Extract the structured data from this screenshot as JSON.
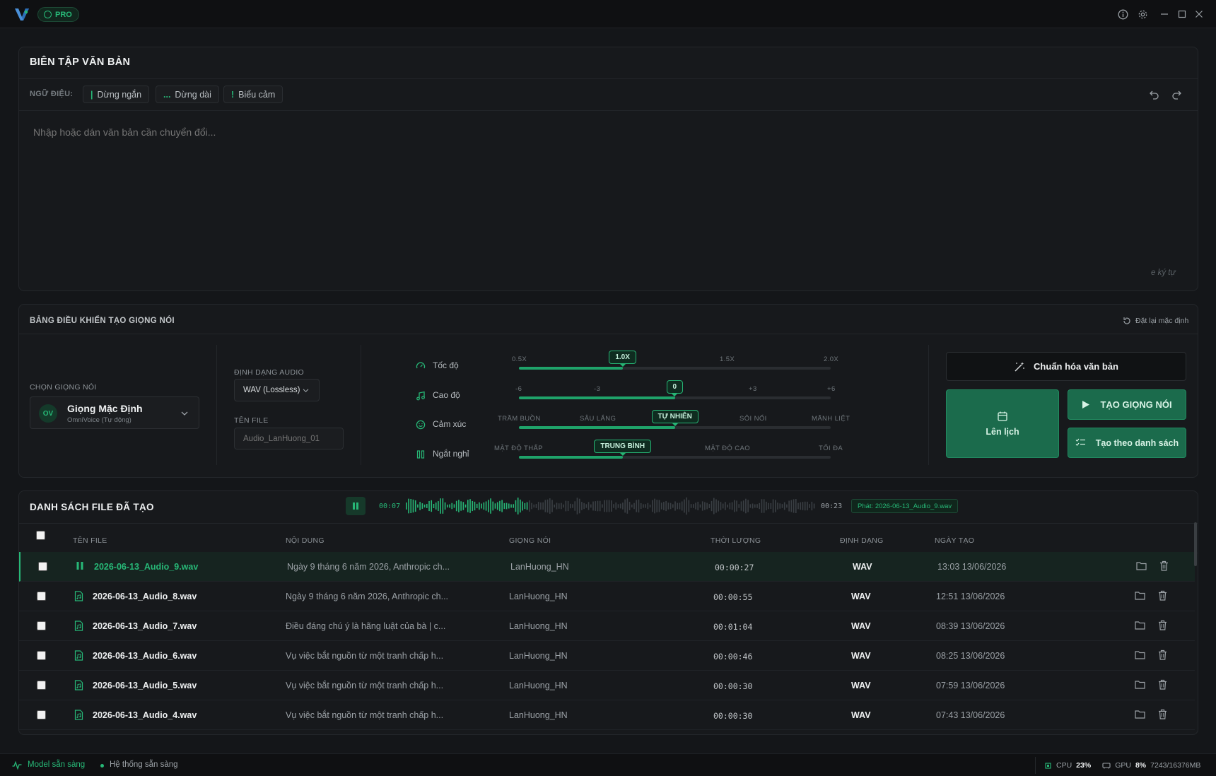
{
  "app": {
    "badge": "PRO"
  },
  "editor": {
    "title": "BIÊN TẬP VĂN BẢN",
    "prosody_label": "NGỮ ĐIỆU:",
    "chips": [
      "Dừng ngắn",
      "Dừng dài",
      "Biểu cảm"
    ],
    "placeholder": "Nhập hoặc dán văn bản cần chuyển đổi...",
    "char_count": "e ký tự"
  },
  "control": {
    "title": "BẢNG ĐIỀU KHIỂN TẠO GIỌNG NÓI",
    "reset": "Đặt lại mặc định",
    "voice_label": "CHỌN GIỌNG NÓI",
    "voice_avatar": "OV",
    "voice_name": "Giọng Mặc Định",
    "voice_sub": "OmniVoice (Tự động)",
    "format_label": "ĐỊNH DẠNG AUDIO",
    "format_value": "WAV (Lossless)",
    "filename_label": "TÊN FILE",
    "filename_placeholder": "Audio_LanHuong_01",
    "sliders": {
      "speed": {
        "label": "Tốc độ",
        "ticks": [
          "0.5X",
          "1.0X",
          "1.5X",
          "2.0X"
        ],
        "value": "1.0X",
        "fraction": 0.333
      },
      "pitch": {
        "label": "Cao độ",
        "ticks": [
          "-6",
          "-3",
          "0",
          "+3",
          "+6"
        ],
        "value": "0",
        "fraction": 0.5
      },
      "emotion": {
        "label": "Cảm xúc",
        "ticks": [
          "TRẦM BUỒN",
          "SÂU LẮNG",
          "TỰ NHIÊN",
          "SÔI NỔI",
          "MÃNH LIỆT"
        ],
        "value": "TỰ NHIÊN",
        "fraction": 0.5
      },
      "pause": {
        "label": "Ngắt nghỉ",
        "ticks": [
          "MẬT ĐỘ THẤP",
          "TRUNG BÌNH",
          "MẬT ĐỘ CAO",
          "TỐI ĐA"
        ],
        "value": "TRUNG BÌNH",
        "fraction": 0.333
      }
    },
    "normalize_btn": "Chuẩn hóa văn bản",
    "schedule_btn": "Lên lịch",
    "generate_btn": "TẠO GIỌNG NÓI",
    "batch_btn": "Tạo theo danh sách"
  },
  "files": {
    "title": "DANH SÁCH FILE ĐÃ TẠO",
    "player": {
      "current": "00:07",
      "total": "00:23",
      "progress": 0.3,
      "playing": "Phát: 2026-06-13_Audio_9.wav"
    },
    "headers": {
      "name": "TÊN FILE",
      "content": "NỘI DUNG",
      "voice": "GIỌNG NÓI",
      "duration": "THỜI LƯỢNG",
      "format": "ĐỊNH DẠNG",
      "date": "NGÀY TẠO"
    },
    "rows": [
      {
        "name": "2026-06-13_Audio_9.wav",
        "content": "Ngày 9 tháng 6 năm 2026, Anthropic ch...",
        "voice": "LanHuong_HN",
        "duration": "00:00:27",
        "format": "WAV",
        "date": "13:03 13/06/2026"
      },
      {
        "name": "2026-06-13_Audio_8.wav",
        "content": "Ngày 9 tháng 6 năm 2026, Anthropic ch...",
        "voice": "LanHuong_HN",
        "duration": "00:00:55",
        "format": "WAV",
        "date": "12:51 13/06/2026"
      },
      {
        "name": "2026-06-13_Audio_7.wav",
        "content": "Điều đáng chú ý là hãng luật của bà | c...",
        "voice": "LanHuong_HN",
        "duration": "00:01:04",
        "format": "WAV",
        "date": "08:39 13/06/2026"
      },
      {
        "name": "2026-06-13_Audio_6.wav",
        "content": "Vụ việc bắt nguồn từ một tranh chấp h...",
        "voice": "LanHuong_HN",
        "duration": "00:00:46",
        "format": "WAV",
        "date": "08:25 13/06/2026"
      },
      {
        "name": "2026-06-13_Audio_5.wav",
        "content": "Vụ việc bắt nguồn từ một tranh chấp h...",
        "voice": "LanHuong_HN",
        "duration": "00:00:30",
        "format": "WAV",
        "date": "07:59 13/06/2026"
      },
      {
        "name": "2026-06-13_Audio_4.wav",
        "content": "Vụ việc bắt nguồn từ một tranh chấp h...",
        "voice": "LanHuong_HN",
        "duration": "00:00:30",
        "format": "WAV",
        "date": "07:43 13/06/2026"
      }
    ]
  },
  "status": {
    "model": "Model sẵn sàng",
    "system": "Hệ thống sẵn sàng",
    "cpu_label": "CPU",
    "cpu_value": "23%",
    "gpu_label": "GPU",
    "gpu_value": "8%",
    "gpu_mem": "7243/16376MB"
  },
  "colors": {
    "accent": "#27b877",
    "bg": "#141619",
    "panel": "#17191c"
  }
}
